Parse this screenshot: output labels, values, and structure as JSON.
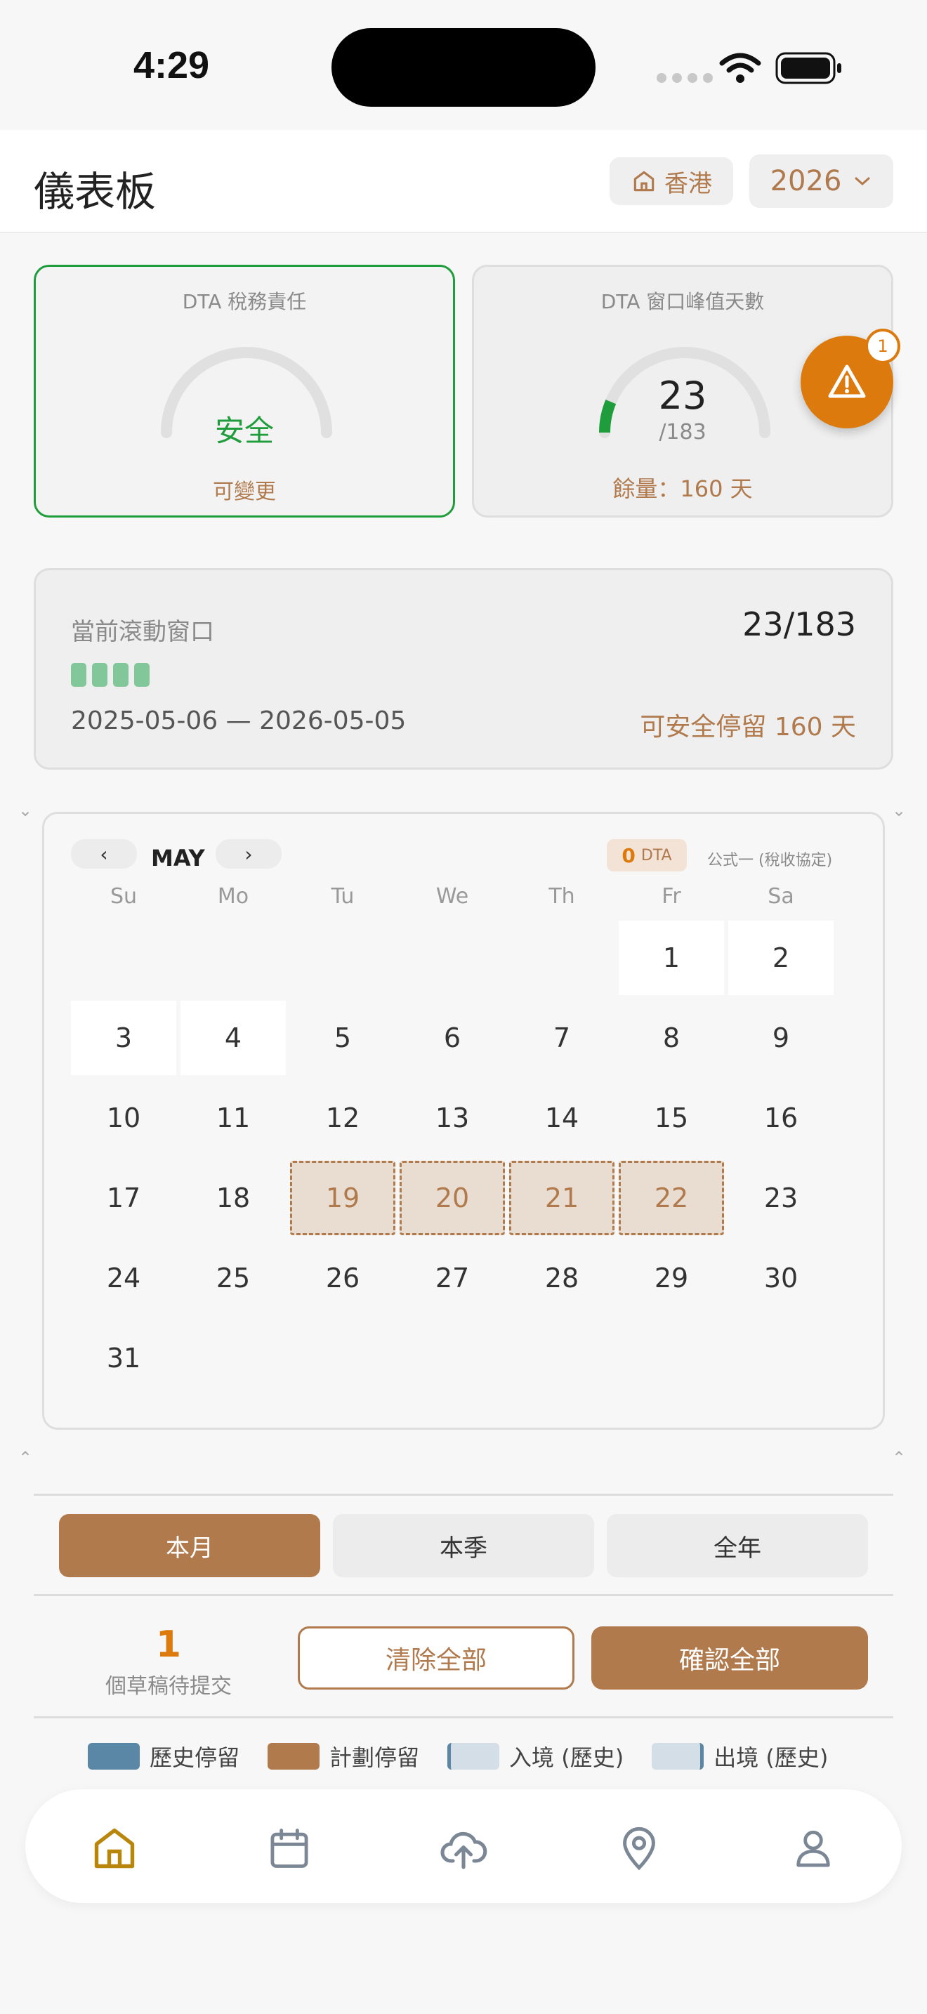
{
  "status_bar": {
    "time": "4:29"
  },
  "header": {
    "title": "儀表板",
    "region": "香港",
    "year": "2026"
  },
  "cards": {
    "dta_liability": {
      "label": "DTA 稅務責任",
      "status": "安全",
      "note": "可變更"
    },
    "dta_peak": {
      "label": "DTA 窗口峰值天數",
      "value": "23",
      "limit": "/183",
      "remaining": "餘量：160 天",
      "progress": 0.1257
    }
  },
  "alert": {
    "count": "1"
  },
  "rolling_window": {
    "label": "當前滾動窗口",
    "ratio": "23/183",
    "range": "2025-05-06 — 2026-05-05",
    "safe_stay": "可安全停留 160 天"
  },
  "calendar": {
    "prev": "‹",
    "next": "›",
    "month": "MAY",
    "dta_count": "0",
    "dta_label": "DTA",
    "treaty_note": "公式一 (稅收協定)",
    "weekdays": [
      "Su",
      "Mo",
      "Tu",
      "We",
      "Th",
      "Fr",
      "Sa"
    ],
    "days": [
      "1",
      "2",
      "3",
      "4",
      "5",
      "6",
      "7",
      "8",
      "9",
      "10",
      "11",
      "12",
      "13",
      "14",
      "15",
      "16",
      "17",
      "18",
      "19",
      "20",
      "21",
      "22",
      "23",
      "24",
      "25",
      "26",
      "27",
      "28",
      "29",
      "30",
      "31"
    ],
    "white_days": [
      "1",
      "2",
      "3",
      "4"
    ],
    "planned_days": [
      "19",
      "20",
      "21",
      "22"
    ]
  },
  "range_tabs": [
    "本月",
    "本季",
    "全年"
  ],
  "drafts": {
    "count": "1",
    "label": "個草稿待提交"
  },
  "actions": {
    "clear": "清除全部",
    "confirm": "確認全部"
  },
  "legend": [
    {
      "label": "歷史停留",
      "color": "#5b87a6"
    },
    {
      "label": "計劃停留",
      "color": "#b07a4d"
    },
    {
      "label": "入境 (歷史)",
      "color": "#d3dee6"
    },
    {
      "label": "出境 (歷史)",
      "color": "#d3dee6"
    }
  ],
  "tabbar": [
    "home-icon",
    "calendar-icon",
    "upload-icon",
    "location-icon",
    "profile-icon"
  ],
  "colors": {
    "accent": "#b07a4d",
    "safe": "#1f9d3c",
    "alert": "#dc7a0d"
  }
}
